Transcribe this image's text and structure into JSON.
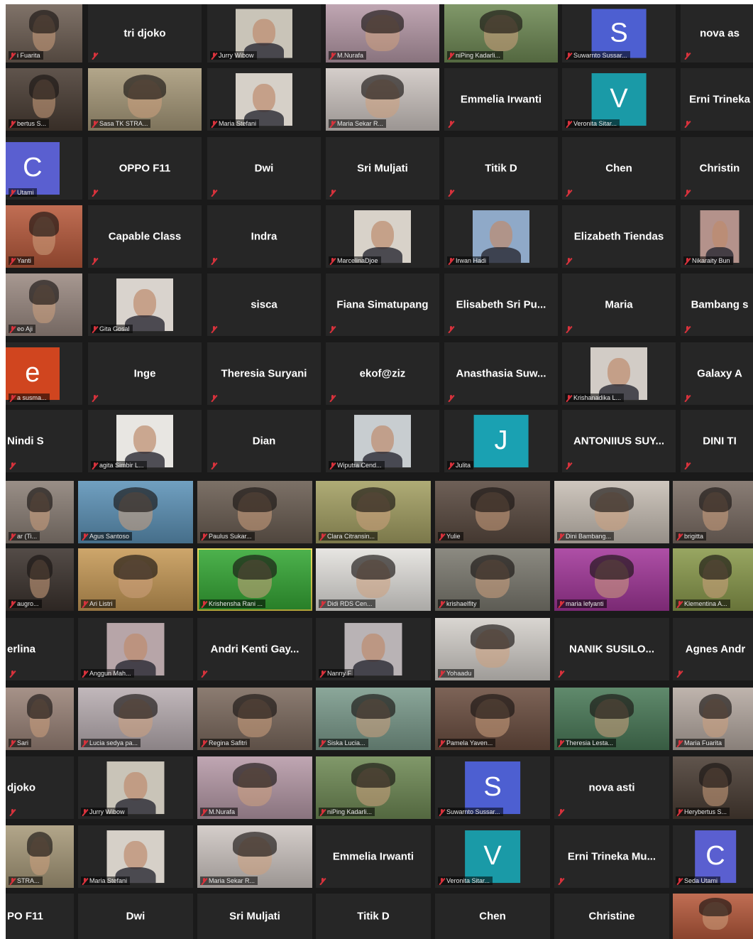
{
  "gallery": {
    "avatar_colors": {
      "S": "#4d5fd1",
      "V": "#1a9aa7",
      "C": "#5a5fd0",
      "e": "#d0451f",
      "J": "#1aa1b2"
    },
    "tiles": [
      {
        "type": "video",
        "tint": "#6e5f54",
        "label": "i Fuarita"
      },
      {
        "type": "name",
        "name": "tri djoko"
      },
      {
        "type": "thumb",
        "tint": "#c9c4b8",
        "label": "Jurry Wibow"
      },
      {
        "type": "video",
        "tint": "#b79aa8",
        "label": "M.Nurafa"
      },
      {
        "type": "video",
        "tint": "#6f8a55",
        "label": "niPing Kadarli..."
      },
      {
        "type": "avatar",
        "letter": "S",
        "color": "#4d5fd1",
        "label": "Suwarnto Sussar..."
      },
      {
        "type": "name",
        "name": "nova as"
      },
      {
        "type": "video",
        "tint": "#4a3d34",
        "label": "bertus S..."
      },
      {
        "type": "video",
        "tint": "#a89a7a",
        "label": "Sasa TK STRA..."
      },
      {
        "type": "thumb",
        "tint": "#d6d0c8",
        "label": "Maria Stefani"
      },
      {
        "type": "video",
        "tint": "#cfc7c3",
        "label": "Maria Sekar R..."
      },
      {
        "type": "name",
        "name": "Emmelia Irwanti"
      },
      {
        "type": "avatar",
        "letter": "V",
        "color": "#1a9aa7",
        "label": "Veronita Sitar..."
      },
      {
        "type": "name",
        "name": "Erni Trineka"
      },
      {
        "type": "avatar",
        "letter": "C",
        "color": "#5a5fd0",
        "label": "Utami",
        "edge": true
      },
      {
        "type": "name",
        "name": "OPPO F11"
      },
      {
        "type": "name",
        "name": "Dwi"
      },
      {
        "type": "name",
        "name": "Sri Muljati"
      },
      {
        "type": "name",
        "name": "Titik D"
      },
      {
        "type": "name",
        "name": "Chen"
      },
      {
        "type": "name",
        "name": "Christin"
      },
      {
        "type": "video",
        "tint": "#b85a3c",
        "label": "Yanti"
      },
      {
        "type": "name",
        "name": "Capable Class"
      },
      {
        "type": "name",
        "name": "Indra"
      },
      {
        "type": "thumb",
        "tint": "#d8d2c9",
        "label": "MarcelinaDjoe"
      },
      {
        "type": "thumb",
        "tint": "#8fa9c8",
        "label": "Irwan Hadi"
      },
      {
        "type": "name",
        "name": "Elizabeth Tiendas"
      },
      {
        "type": "thumb",
        "tint": "#b4928b",
        "label": "Nikaraity Bun"
      },
      {
        "type": "video",
        "tint": "#9b8a82",
        "label": "eo Aji"
      },
      {
        "type": "thumb",
        "tint": "#d9d3cd",
        "label": "Gita Gosal"
      },
      {
        "type": "name",
        "name": "sisca"
      },
      {
        "type": "name",
        "name": "Fiana Simatupang"
      },
      {
        "type": "name",
        "name": "Elisabeth Sri Pu..."
      },
      {
        "type": "name",
        "name": "Maria"
      },
      {
        "type": "name",
        "name": "Bambang s"
      },
      {
        "type": "avatar",
        "letter": "e",
        "color": "#d0451f",
        "label": "a susma...",
        "edge": true
      },
      {
        "type": "name",
        "name": "Inge"
      },
      {
        "type": "name",
        "name": "Theresia Suryani"
      },
      {
        "type": "name",
        "name": "ekof@ziz"
      },
      {
        "type": "name",
        "name": "Anasthasia Suw..."
      },
      {
        "type": "thumb",
        "tint": "#d2ccc6",
        "label": "Krishanadika L..."
      },
      {
        "type": "name",
        "name": "Galaxy A"
      },
      {
        "type": "name",
        "name": "Nindi S",
        "left": true
      },
      {
        "type": "thumb",
        "tint": "#e8e6e2",
        "label": "agita Simbir L..."
      },
      {
        "type": "name",
        "name": "Dian"
      },
      {
        "type": "thumb",
        "tint": "#c8cdd0",
        "label": "Wiputra Cend..."
      },
      {
        "type": "avatar",
        "letter": "J",
        "color": "#1aa1b2",
        "label": "Julita"
      },
      {
        "type": "name",
        "name": "ANTONIIUS SUY..."
      },
      {
        "type": "name",
        "name": "DINI TI"
      },
      {
        "type": "video",
        "tint": "#8b7f76",
        "label": "ar (Ti..."
      },
      {
        "type": "video",
        "tint": "#5d93b8",
        "label": "Agus Santoso"
      },
      {
        "type": "video",
        "tint": "#6a5d52",
        "label": "Paulus Sukar..."
      },
      {
        "type": "video",
        "tint": "#a4a063",
        "label": "Clara Citransin..."
      },
      {
        "type": "video",
        "tint": "#5a4a40",
        "label": "Yulie"
      },
      {
        "type": "video",
        "tint": "#c8bfb5",
        "label": "Dini Bambang..."
      },
      {
        "type": "video",
        "tint": "#7a6c63",
        "label": "brigitta"
      },
      {
        "type": "video",
        "tint": "#3c332e",
        "label": "augro..."
      },
      {
        "type": "video",
        "tint": "#c79a57",
        "label": "Ari Listri"
      },
      {
        "type": "video",
        "tint": "#35a835",
        "label": "Krishensha Rani ...",
        "active": true
      },
      {
        "type": "video",
        "tint": "#e4e2de",
        "label": "Didi RDS Cen..."
      },
      {
        "type": "video",
        "tint": "#7c7a70",
        "label": "krishaelfity"
      },
      {
        "type": "video",
        "tint": "#a3379a",
        "label": "maria lefyanti"
      },
      {
        "type": "video",
        "tint": "#8a9a4c",
        "label": "Klementina A..."
      },
      {
        "type": "name",
        "name": "erlina",
        "left": true
      },
      {
        "type": "thumb",
        "tint": "#b7a5a8",
        "label": "Anggun Mah..."
      },
      {
        "type": "name",
        "name": "Andri Kenti Gay..."
      },
      {
        "type": "thumb",
        "tint": "#b9b3b5",
        "label": "Nanny F"
      },
      {
        "type": "video",
        "tint": "#d4d0cb",
        "label": "Yohaadu"
      },
      {
        "type": "name",
        "name": "NANIK SUSILO..."
      },
      {
        "type": "name",
        "name": "Agnes Andr"
      },
      {
        "type": "video",
        "tint": "#9a8378",
        "label": "Sari"
      },
      {
        "type": "video",
        "tint": "#b9aeb2",
        "label": "Lucia sedya pa..."
      },
      {
        "type": "video",
        "tint": "#7c6a5e",
        "label": "Regina Safitri"
      },
      {
        "type": "video",
        "tint": "#7b9b8c",
        "label": "Siska Lucia..."
      },
      {
        "type": "video",
        "tint": "#6b4e40",
        "label": "Pamela Yaven..."
      },
      {
        "type": "video",
        "tint": "#4a7a58",
        "label": "Theresia Lesta..."
      },
      {
        "type": "video",
        "tint": "#b6aaa2",
        "label": "Maria Fuarita"
      },
      {
        "type": "name",
        "name": "djoko",
        "left": true
      },
      {
        "type": "thumb",
        "tint": "#c9c4b8",
        "label": "Jurry Wibow"
      },
      {
        "type": "video",
        "tint": "#b79aa8",
        "label": "M.Nurafa"
      },
      {
        "type": "video",
        "tint": "#6f8a55",
        "label": "niPing Kadarli..."
      },
      {
        "type": "avatar",
        "letter": "S",
        "color": "#4d5fd1",
        "label": "Suwarnto Sussar..."
      },
      {
        "type": "name",
        "name": "nova asti"
      },
      {
        "type": "video",
        "tint": "#4a3d34",
        "label": "Herybertus S..."
      },
      {
        "type": "video",
        "tint": "#a89a7a",
        "label": "STRA..."
      },
      {
        "type": "thumb",
        "tint": "#d6d0c8",
        "label": "Maria Stefani"
      },
      {
        "type": "video",
        "tint": "#cfc7c3",
        "label": "Maria Sekar R..."
      },
      {
        "type": "name",
        "name": "Emmelia Irwanti"
      },
      {
        "type": "avatar",
        "letter": "V",
        "color": "#1a9aa7",
        "label": "Veronita Sitar..."
      },
      {
        "type": "name",
        "name": "Erni Trineka Mu..."
      },
      {
        "type": "avatar",
        "letter": "C",
        "color": "#5a5fd0",
        "label": "Seda Utami"
      },
      {
        "type": "name",
        "name": "PO F11",
        "left": true
      },
      {
        "type": "name",
        "name": "Dwi"
      },
      {
        "type": "name",
        "name": "Sri Muljati"
      },
      {
        "type": "name",
        "name": "Titik D"
      },
      {
        "type": "name",
        "name": "Chen"
      },
      {
        "type": "name",
        "name": "Christine"
      },
      {
        "type": "video",
        "tint": "#b85a3c",
        "label": ""
      }
    ]
  }
}
